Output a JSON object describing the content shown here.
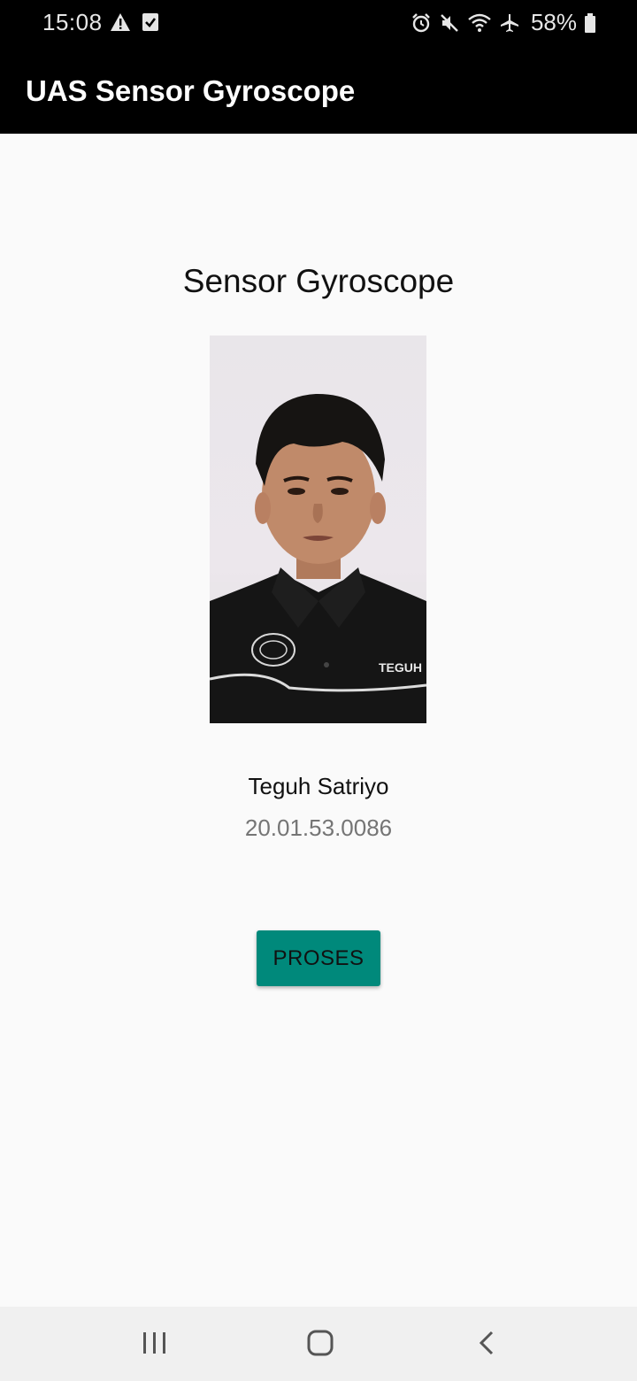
{
  "status_bar": {
    "time": "15:08",
    "battery": "58%",
    "left_icons": [
      "warning-icon",
      "checkbox-icon"
    ],
    "right_icons": [
      "alarm-icon",
      "mute-icon",
      "wifi-icon",
      "airplane-icon",
      "battery-icon"
    ]
  },
  "app_bar": {
    "title": "UAS Sensor Gyroscope"
  },
  "main": {
    "heading": "Sensor Gyroscope",
    "name": "Teguh Satriyo",
    "nim": "20.01.53.0086",
    "button_label": "PROSES",
    "shirt_name": "TEGUH"
  },
  "nav_bar": {
    "buttons": [
      "recent-apps-icon",
      "home-icon",
      "back-icon"
    ]
  },
  "colors": {
    "accent": "#00897b",
    "app_bar": "#000000",
    "background": "#fafafa"
  }
}
